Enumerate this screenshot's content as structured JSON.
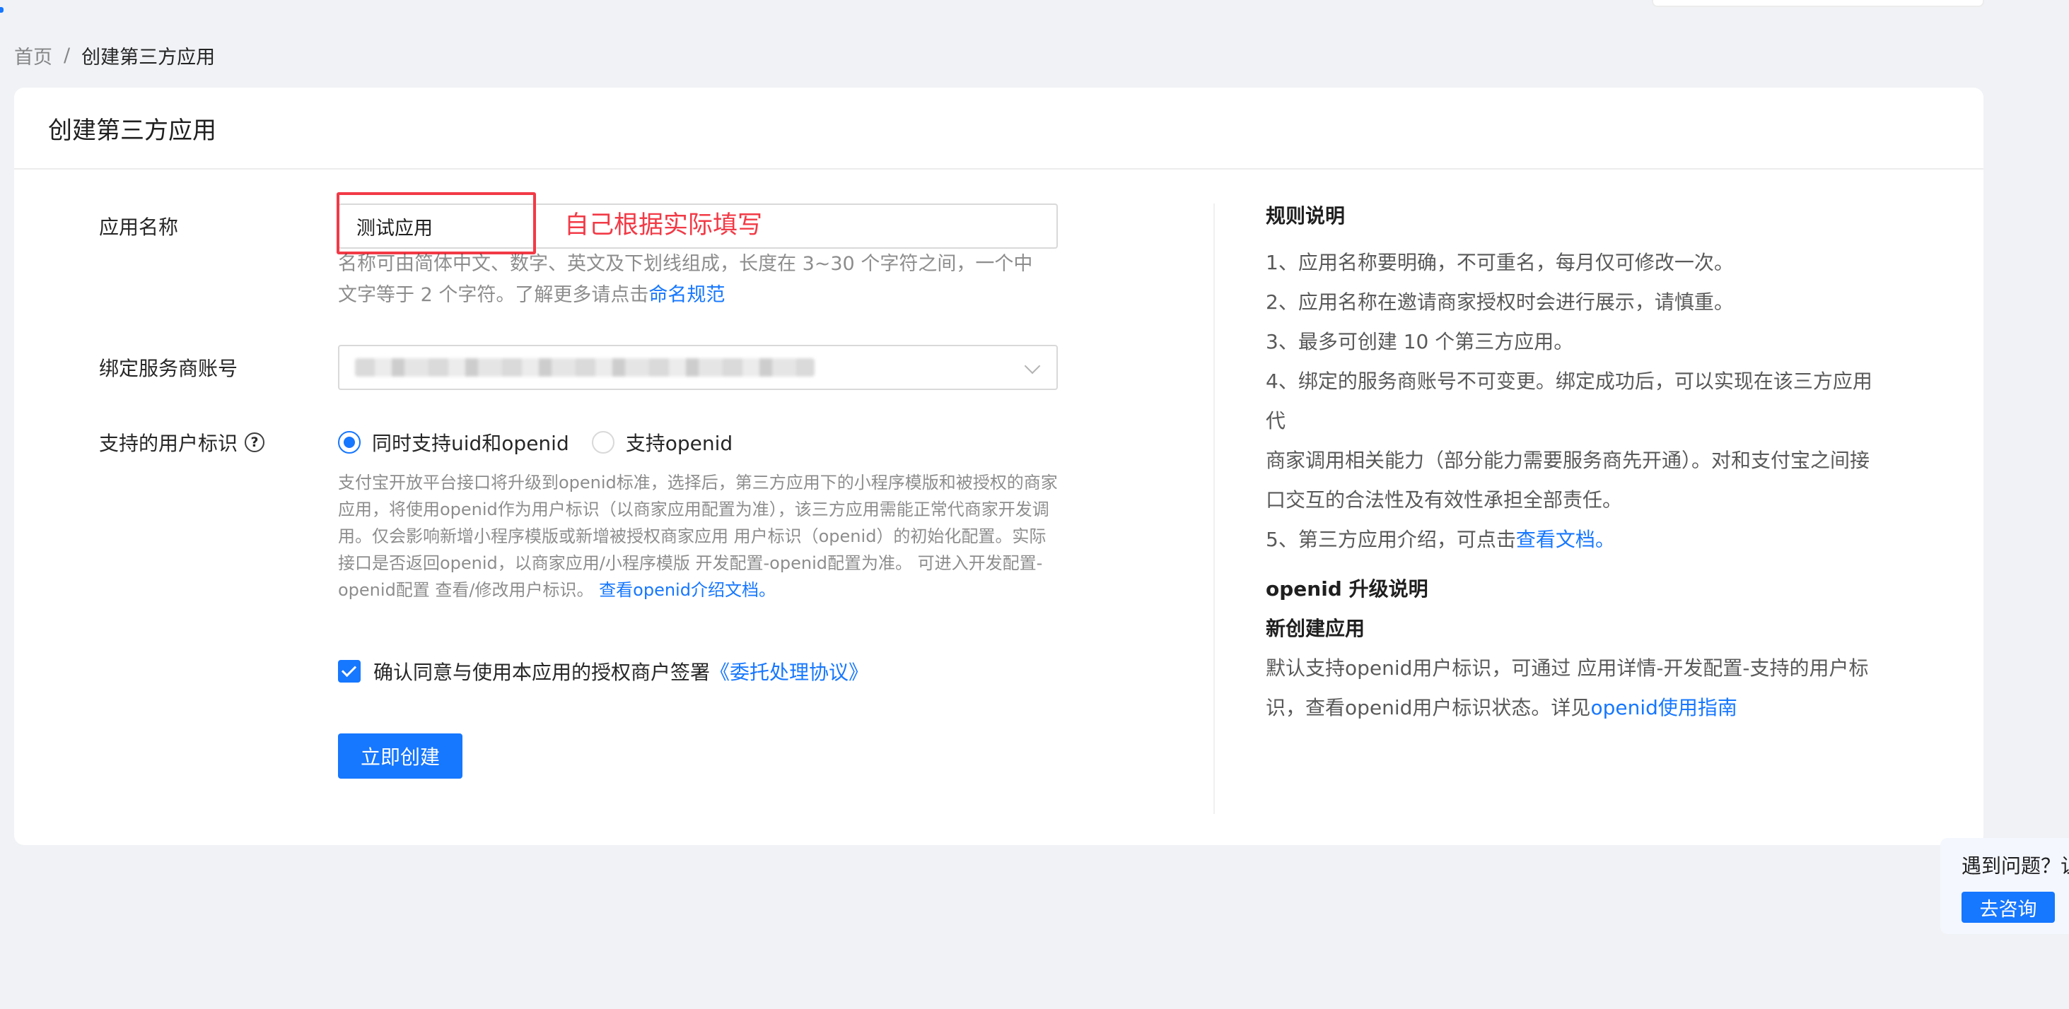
{
  "breadcrumb": {
    "home": "首页",
    "separator": "/",
    "current": "创建第三方应用"
  },
  "card": {
    "title": "创建第三方应用"
  },
  "form": {
    "app_name": {
      "label": "应用名称",
      "value": "测试应用",
      "annotation": "自己根据实际填写",
      "hint_line1": "名称可由简体中文、数字、英文及下划线组成，长度在 3~30 个字符之间，一个中",
      "hint_line2": "文字等于 2 个字符。了解更多请点击",
      "hint_link": "命名规范"
    },
    "service_account": {
      "label": "绑定服务商账号"
    },
    "user_id": {
      "label": "支持的用户标识",
      "help_icon": "?",
      "options": [
        {
          "label": "同时支持uid和openid",
          "checked": true
        },
        {
          "label": "支持openid",
          "checked": false
        }
      ],
      "note_line1": "支付宝开放平台接口将升级到openid标准，选择后，第三方应用下的小程序模版和被授权的商家",
      "note_line2": "应用，将使用openid作为用户标识（以商家应用配置为准），该三方应用需能正常代商家开发调",
      "note_line3": "用。仅会影响新增小程序模版或新增被授权商家应用 用户标识（openid）的初始化配置。实际",
      "note_line4": "接口是否返回openid，以商家应用/小程序模版 开发配置-openid配置为准。 可进入开发配置-",
      "note_line5": "openid配置 查看/修改用户标识。",
      "note_link": "查看openid介绍文档。"
    },
    "agreement": {
      "text": "确认同意与使用本应用的授权商户签署",
      "link": "《委托处理协议》",
      "checked": true
    },
    "submit_label": "立即创建"
  },
  "rules": {
    "title": "规则说明",
    "items": [
      "1、应用名称要明确，不可重名，每月仅可修改一次。",
      "2、应用名称在邀请商家授权时会进行展示，请慎重。",
      "3、最多可创建 10 个第三方应用。"
    ],
    "item4_line1": "4、绑定的服务商账号不可变更。绑定成功后，可以实现在该三方应用代",
    "item4_line2": "商家调用相关能力（部分能力需要服务商先开通）。对和支付宝之间接",
    "item4_line3": "口交互的合法性及有效性承担全部责任。",
    "item5_text": "5、第三方应用介绍，可点击",
    "item5_link": "查看文档。",
    "openid_title": "openid 升级说明",
    "new_app_title": "新创建应用",
    "openid_line1": "默认支持openid用户标识，可通过 应用详情-开发配置-支持的用户标",
    "openid_line2": "识，查看openid用户标识状态。详见",
    "openid_link": "openid使用指南"
  },
  "float_help": {
    "text": "遇到问题？让",
    "button": "去咨询"
  },
  "colors": {
    "primary": "#1677ff",
    "annotation_red": "#f23a46",
    "background": "#f0f2f5"
  },
  "icons": {
    "select_arrow": "chevron-down-icon",
    "help": "question-circle-icon",
    "check": "checkmark-icon"
  }
}
